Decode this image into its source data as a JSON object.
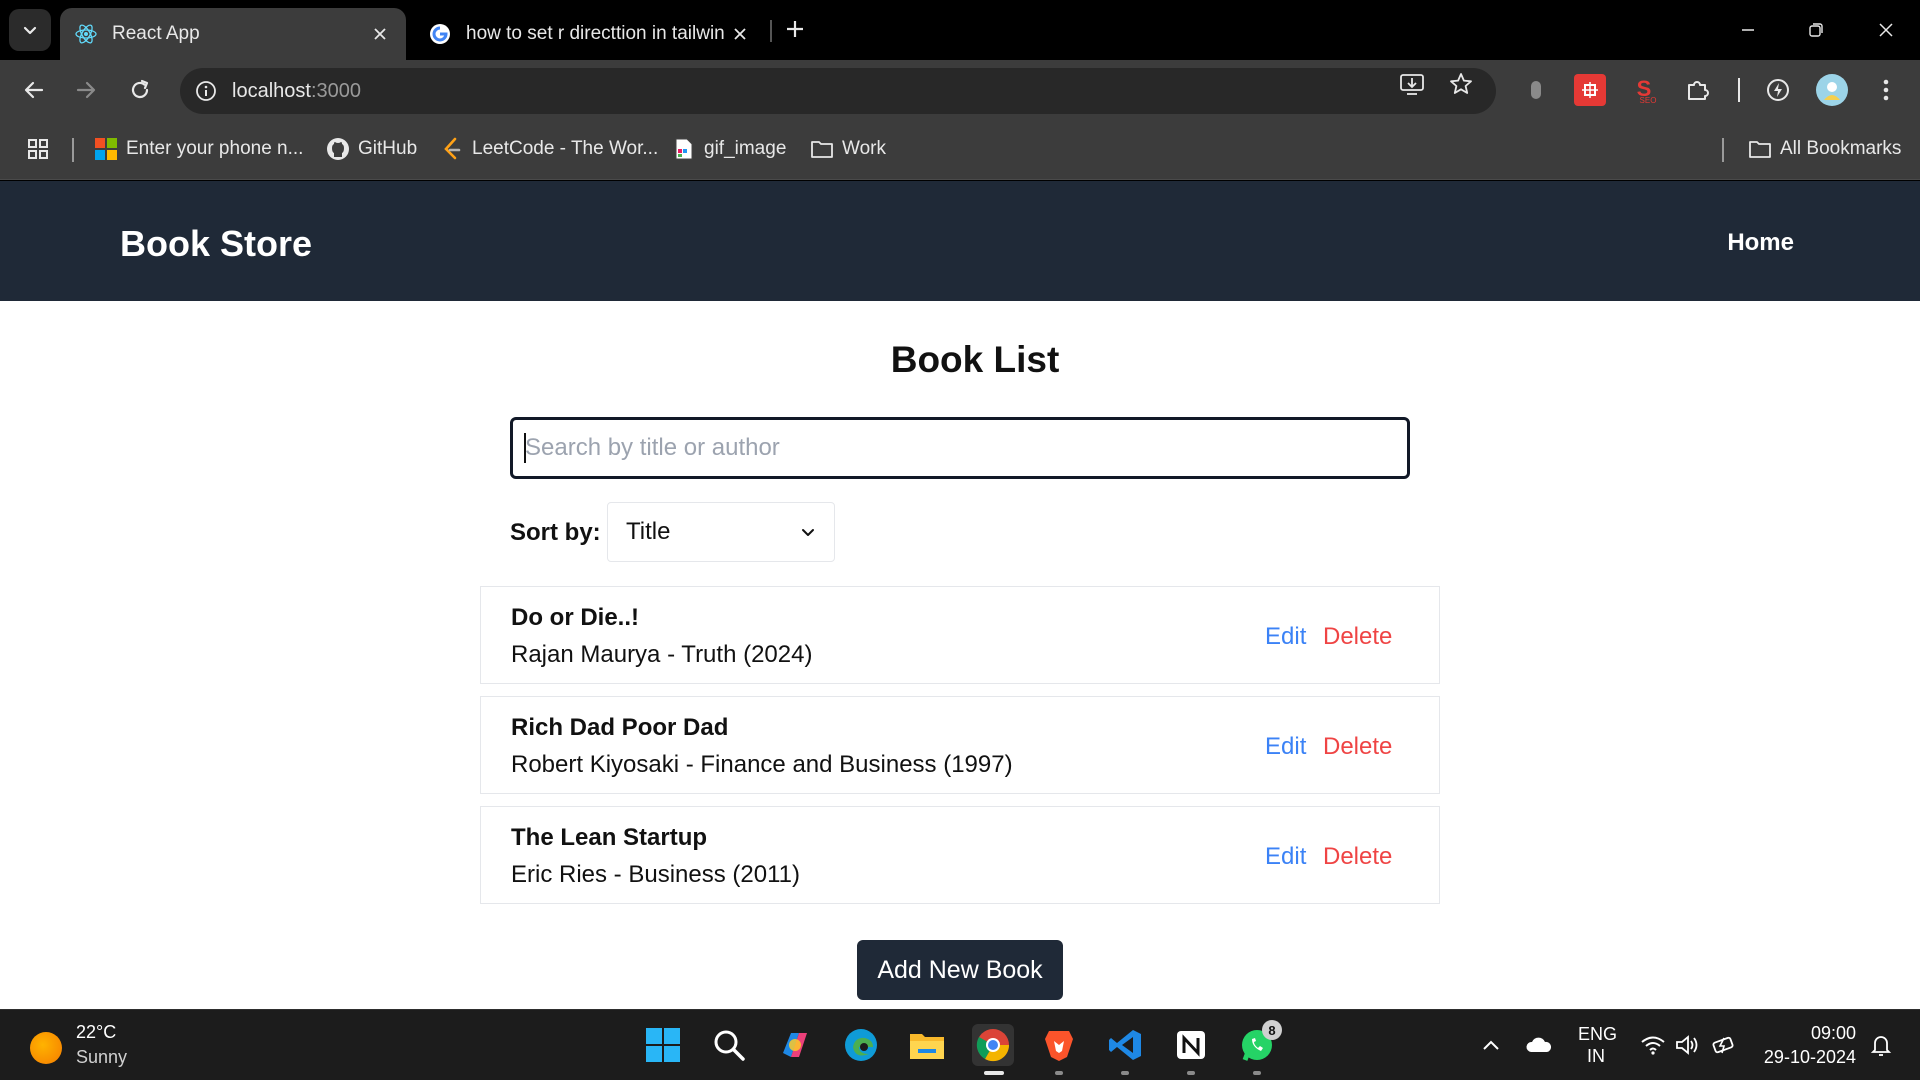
{
  "browser": {
    "tabs": [
      {
        "title": "React App",
        "favicon": "react-icon",
        "active": true
      },
      {
        "title": "how to set r directtion in tailwin",
        "favicon": "google-icon",
        "active": false
      }
    ],
    "url": {
      "host": "localhost",
      "port": ":3000"
    },
    "bookmarks": [
      {
        "label": "Enter your phone n...",
        "icon": "microsoft-icon"
      },
      {
        "label": "GitHub",
        "icon": "github-icon"
      },
      {
        "label": "LeetCode - The Wor...",
        "icon": "leetcode-icon"
      },
      {
        "label": "gif_image",
        "icon": "file-icon"
      },
      {
        "label": "Work",
        "icon": "folder-icon"
      }
    ],
    "all_bookmarks": "All Bookmarks"
  },
  "app": {
    "brand": "Book Store",
    "nav": {
      "home": "Home"
    },
    "title": "Book List",
    "search": {
      "placeholder": "Search by title or author",
      "value": ""
    },
    "sort": {
      "label": "Sort by:",
      "selected": "Title"
    },
    "books": [
      {
        "title": "Do or Die..!",
        "subtitle": "Rajan Maurya - Truth (2024)",
        "edit": "Edit",
        "delete": "Delete"
      },
      {
        "title": "Rich Dad Poor Dad",
        "subtitle": "Robert Kiyosaki - Finance and Business (1997)",
        "edit": "Edit",
        "delete": "Delete"
      },
      {
        "title": "The Lean Startup",
        "subtitle": "Eric Ries - Business (2011)",
        "edit": "Edit",
        "delete": "Delete"
      }
    ],
    "add_button": "Add New Book"
  },
  "taskbar": {
    "weather": {
      "temp": "22°C",
      "condition": "Sunny"
    },
    "whatsapp_badge": "8",
    "lang": {
      "line1": "ENG",
      "line2": "IN"
    },
    "time": "09:00",
    "date": "29-10-2024"
  },
  "colors": {
    "navbar": "#1f2937",
    "edit_link": "#3b82f6",
    "delete_link": "#ef4444"
  }
}
